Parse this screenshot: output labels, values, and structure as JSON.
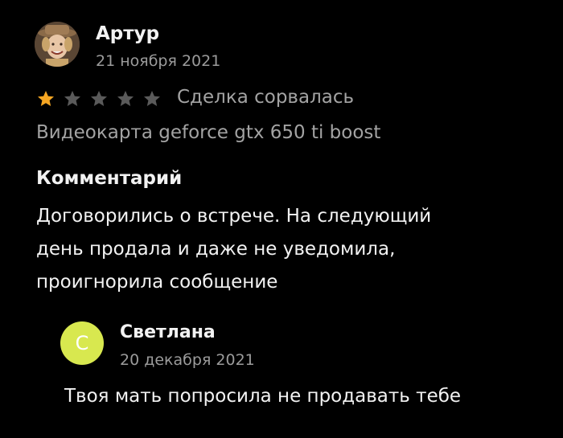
{
  "review": {
    "author": {
      "name": "Артур",
      "date": "21 ноября 2021",
      "avatar_icon": "user-photo-icon"
    },
    "rating": {
      "value": 1,
      "max": 5,
      "filled_color": "#f5a623",
      "empty_color": "#5a5a5a"
    },
    "status": "Сделка сорвалась",
    "item": "Видеокарта geforce gtx 650 ti boost",
    "comment": {
      "heading": "Комментарий",
      "text": "Договорились о встрече. На следующий\nдень продала и даже не уведомила,\nпроигнорила сообщение"
    }
  },
  "reply": {
    "author": {
      "name": "Светлана",
      "date": "20 декабря 2021",
      "initial": "С",
      "avatar_color": "#d8e84f"
    },
    "text": "Твоя мать попросила не продавать тебе"
  }
}
